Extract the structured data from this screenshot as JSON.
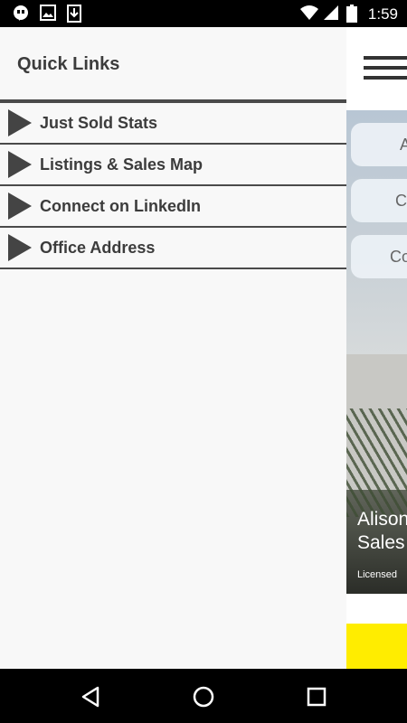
{
  "status_bar": {
    "time": "1:59",
    "left_icons": [
      "hangouts-icon",
      "image-icon",
      "download-icon"
    ],
    "right_icons": [
      "wifi-icon",
      "signal-icon",
      "battery-icon"
    ]
  },
  "drawer": {
    "title": "Quick Links",
    "items": [
      {
        "label": "Just Sold Stats",
        "icon": "play-arrow-icon"
      },
      {
        "label": "Listings & Sales Map",
        "icon": "play-arrow-icon"
      },
      {
        "label": "Connect on LinkedIn",
        "icon": "play-arrow-icon"
      },
      {
        "label": "Office Address",
        "icon": "play-arrow-icon"
      }
    ]
  },
  "background": {
    "menu_icon": "hamburger-icon",
    "buttons": [
      "A",
      "Cl",
      "Co"
    ],
    "agent_name_line1": "Alison",
    "agent_name_line2": "Sales",
    "licensed_text": "Licensed",
    "accent_color": "#ffed00"
  },
  "nav_bar": {
    "buttons": [
      "back-icon",
      "home-icon",
      "recents-icon"
    ]
  }
}
